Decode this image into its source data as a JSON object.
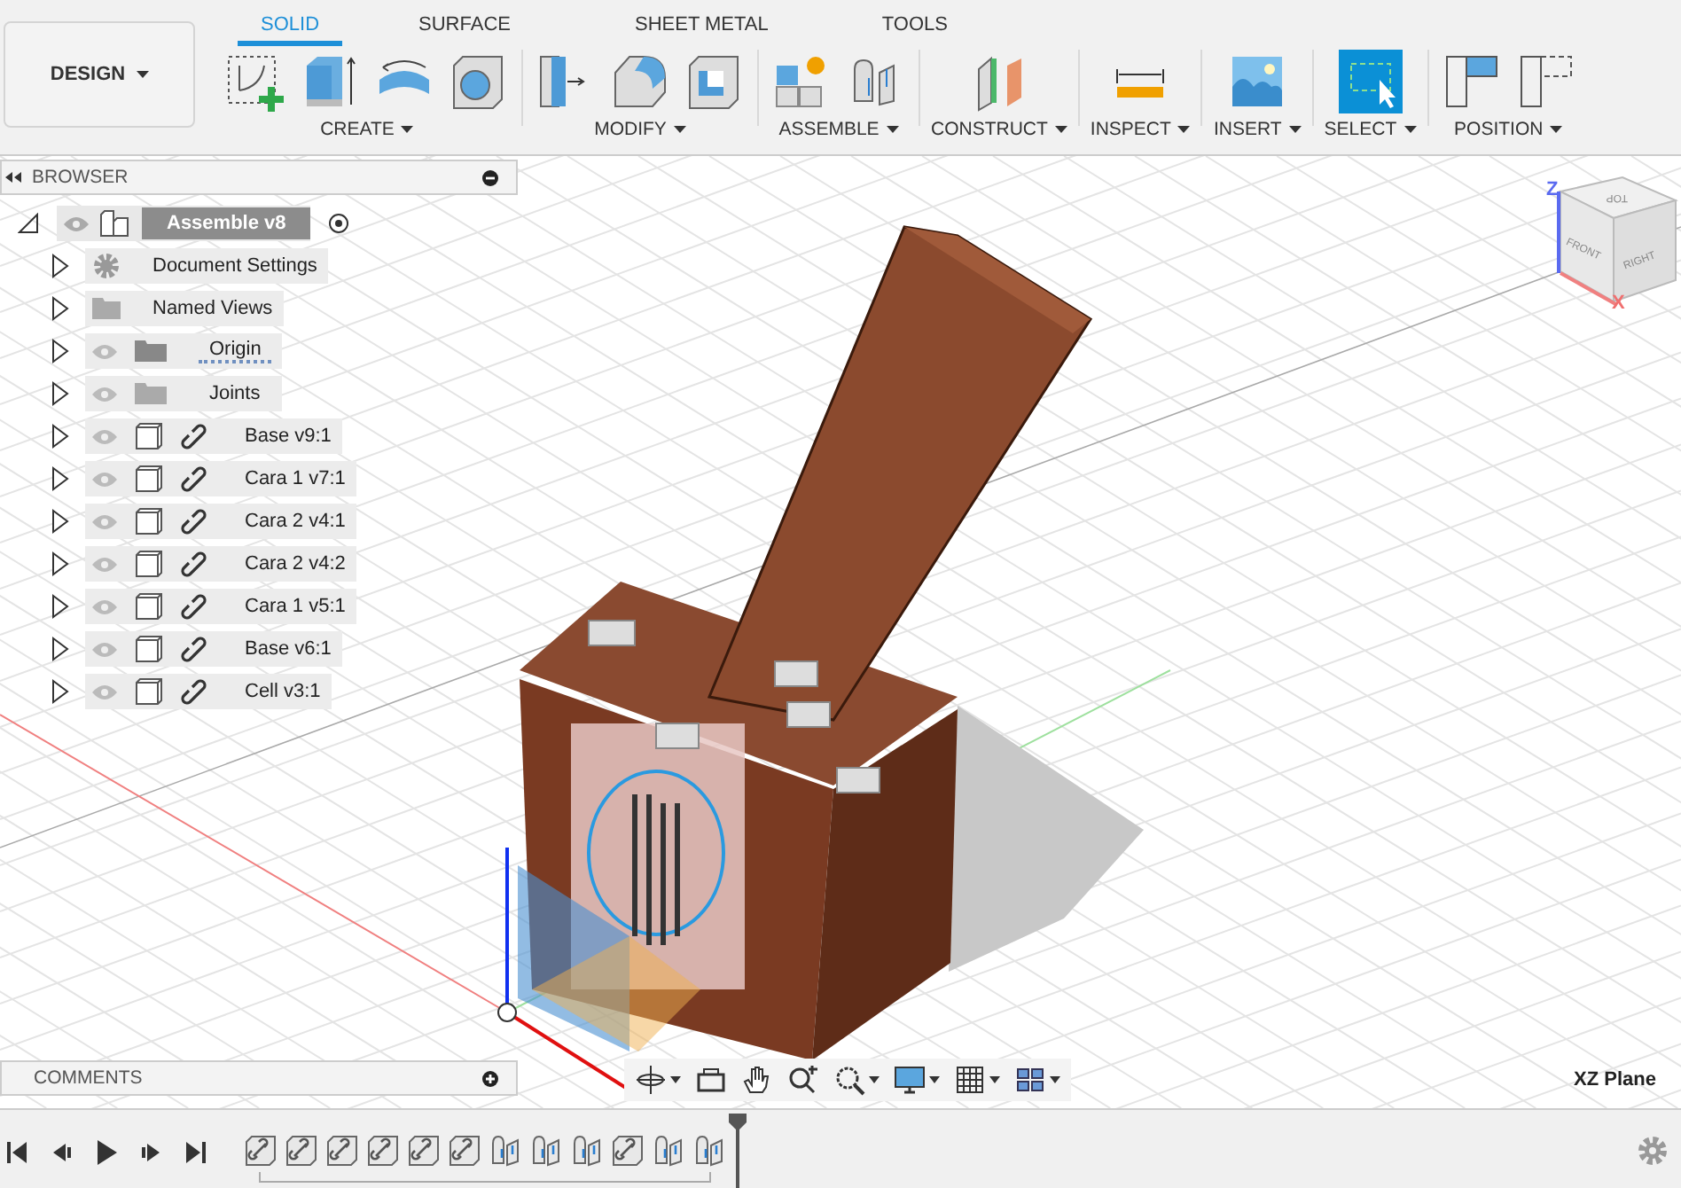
{
  "workspace": {
    "label": "DESIGN"
  },
  "tabs": [
    {
      "label": "SOLID",
      "selected": true
    },
    {
      "label": "SURFACE",
      "selected": false
    },
    {
      "label": "SHEET METAL",
      "selected": false
    },
    {
      "label": "TOOLS",
      "selected": false
    }
  ],
  "tool_groups": [
    {
      "label": "CREATE",
      "tools": [
        {
          "kind": "sketch",
          "selected": false
        },
        {
          "kind": "extrude",
          "selected": false
        },
        {
          "kind": "revolve",
          "selected": false
        },
        {
          "kind": "hole",
          "selected": false
        }
      ]
    },
    {
      "label": "MODIFY",
      "tools": [
        {
          "kind": "presspull",
          "selected": false
        },
        {
          "kind": "fillet",
          "selected": false
        },
        {
          "kind": "shell",
          "selected": false
        }
      ]
    },
    {
      "label": "ASSEMBLE",
      "tools": [
        {
          "kind": "new-component",
          "selected": false
        },
        {
          "kind": "joint",
          "selected": false
        }
      ]
    },
    {
      "label": "CONSTRUCT",
      "tools": [
        {
          "kind": "plane",
          "selected": false
        }
      ]
    },
    {
      "label": "INSPECT",
      "tools": [
        {
          "kind": "measure",
          "selected": false
        }
      ]
    },
    {
      "label": "INSERT",
      "tools": [
        {
          "kind": "image",
          "selected": false
        }
      ]
    },
    {
      "label": "SELECT",
      "tools": [
        {
          "kind": "select",
          "selected": true
        }
      ]
    },
    {
      "label": "POSITION",
      "tools": [
        {
          "kind": "capture",
          "selected": false
        },
        {
          "kind": "revert",
          "selected": false
        }
      ]
    }
  ],
  "browser": {
    "title": "BROWSER",
    "root": {
      "label": "Assemble v8",
      "expanded": true,
      "children": [
        {
          "kind": "settings",
          "label": "Document Settings",
          "expanded": false
        },
        {
          "kind": "views",
          "label": "Named Views",
          "expanded": false
        },
        {
          "kind": "origin",
          "label": "Origin",
          "expanded": false
        },
        {
          "kind": "folder",
          "label": "Joints",
          "expanded": false
        },
        {
          "kind": "component",
          "label": "Base v9:1",
          "expanded": false
        },
        {
          "kind": "component",
          "label": "Cara 1 v7:1",
          "expanded": false
        },
        {
          "kind": "component",
          "label": "Cara 2 v4:1",
          "expanded": false
        },
        {
          "kind": "component",
          "label": "Cara 2 v4:2",
          "expanded": false
        },
        {
          "kind": "component",
          "label": "Cara 1 v5:1",
          "expanded": false
        },
        {
          "kind": "component",
          "label": "Base v6:1",
          "expanded": false
        },
        {
          "kind": "component",
          "label": "Cell v3:1",
          "expanded": false
        }
      ]
    }
  },
  "view_cube": {
    "top": "TOP",
    "front": "FRONT",
    "right": "RIGHT",
    "z_axis": "Z",
    "x_axis": "X"
  },
  "comments": {
    "title": "COMMENTS"
  },
  "nav_tools": [
    {
      "kind": "orbit",
      "menu": true
    },
    {
      "kind": "look",
      "menu": false
    },
    {
      "kind": "pan",
      "menu": false
    },
    {
      "kind": "zoom",
      "menu": false
    },
    {
      "kind": "fit",
      "menu": true
    },
    {
      "kind": "display",
      "menu": true
    },
    {
      "kind": "grid",
      "menu": true
    },
    {
      "kind": "viewports",
      "menu": true
    }
  ],
  "status": {
    "plane": "XZ Plane"
  },
  "timeline": {
    "items": [
      {
        "kind": "component"
      },
      {
        "kind": "component"
      },
      {
        "kind": "component"
      },
      {
        "kind": "component"
      },
      {
        "kind": "component"
      },
      {
        "kind": "component"
      },
      {
        "kind": "joint"
      },
      {
        "kind": "joint"
      },
      {
        "kind": "joint"
      },
      {
        "kind": "component"
      },
      {
        "kind": "joint"
      },
      {
        "kind": "joint"
      }
    ]
  }
}
